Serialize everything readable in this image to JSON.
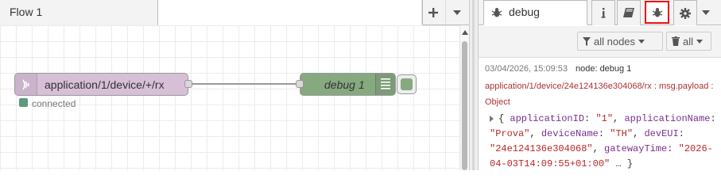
{
  "workspace": {
    "tab_label": "Flow 1",
    "add_icon": "plus-icon",
    "menu_icon": "caret-down-icon"
  },
  "nodes": {
    "mqtt_in": {
      "label": "application/1/device/+/rx",
      "icon": "mqtt-signal-icon",
      "color": "#d8bfd8",
      "status_text": "connected",
      "status_color": "#5a9a7d"
    },
    "debug": {
      "label": "debug 1",
      "icon": "list-icon",
      "color": "#87a980"
    }
  },
  "sidebar": {
    "active_tab_label": "debug",
    "tabs": [
      "info-icon",
      "book-icon",
      "bug-icon",
      "gear-icon"
    ],
    "toolbar": {
      "filter_label": "all nodes",
      "clear_label": "all"
    },
    "message": {
      "timestamp": "03/04/2026, 15:09:53",
      "node": "node: debug 1",
      "topic": "application/1/device/24e124136e304068/rx : msg.payload : Object",
      "body": {
        "applicationID_key": "applicationID",
        "applicationID_val": "\"1\"",
        "applicationName_key": "applicationName",
        "applicationName_val": "\"Prova\"",
        "deviceName_key": "deviceName",
        "deviceName_val": "\"TH\"",
        "devEUI_key": "devEUI",
        "devEUI_val": "\"24e124136e304068\"",
        "gatewayTime_key": "gatewayTime",
        "gatewayTime_val": "\"2026-04-03T14:09:55+01:00\"",
        "ellipsis": "…"
      }
    }
  }
}
